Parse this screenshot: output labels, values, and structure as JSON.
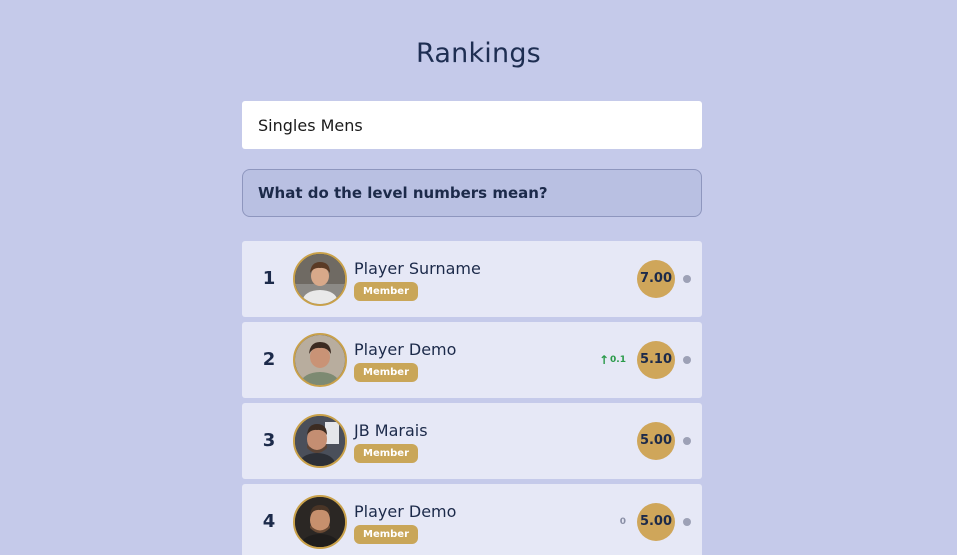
{
  "page": {
    "title": "Rankings"
  },
  "category_select": {
    "value": "Singles Mens"
  },
  "info": {
    "label": "What do the level numbers mean?"
  },
  "colors": {
    "background": "#c5caea",
    "row_background": "#e6e8f6",
    "gold": "#cfa65a",
    "positive_change": "#2a9a4a"
  },
  "players": [
    {
      "rank": "1",
      "name": "Player Surname",
      "badge": "Member",
      "level": "7.00",
      "change": "",
      "avatar": "player-photo-icon"
    },
    {
      "rank": "2",
      "name": "Player Demo",
      "badge": "Member",
      "level": "5.10",
      "change": "0.1",
      "change_direction": "up",
      "avatar": "player-photo-icon"
    },
    {
      "rank": "3",
      "name": "JB Marais",
      "badge": "Member",
      "level": "5.00",
      "change": "",
      "avatar": "player-photo-icon"
    },
    {
      "rank": "4",
      "name": "Player Demo",
      "badge": "Member",
      "level": "5.00",
      "change": "0",
      "change_direction": "none",
      "avatar": "player-photo-icon"
    }
  ]
}
